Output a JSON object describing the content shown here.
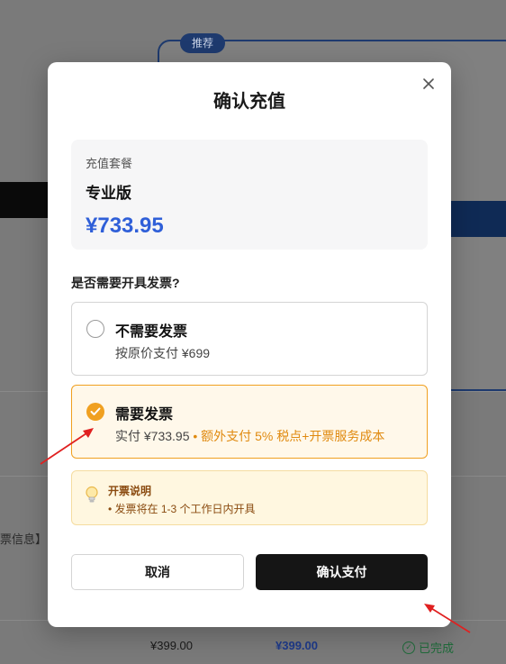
{
  "background": {
    "recommend_badge": "推荐",
    "left_fragment": "票信息】:",
    "table_row": {
      "price": "¥399.00",
      "paid": "¥399.00",
      "status": "已完成"
    }
  },
  "modal": {
    "title": "确认充值",
    "plan": {
      "label": "充值套餐",
      "name": "专业版",
      "price": "¥733.95"
    },
    "invoice_question": "是否需要开具发票?",
    "options": [
      {
        "title": "不需要发票",
        "subtitle": "按原价支付 ¥699",
        "selected": false
      },
      {
        "title": "需要发票",
        "subtitle": "实付 ¥733.95",
        "extra": "• 额外支付 5% 税点+开票服务成本",
        "selected": true
      }
    ],
    "note": {
      "title": "开票说明",
      "item": "• 发票将在 1-3 个工作日内开具"
    },
    "cancel_label": "取消",
    "confirm_label": "确认支付"
  },
  "colors": {
    "accent": "#2f5fd8",
    "selected_orange": "#f0a020",
    "confirm_bg": "#151515",
    "annotation_red": "#e02020"
  }
}
